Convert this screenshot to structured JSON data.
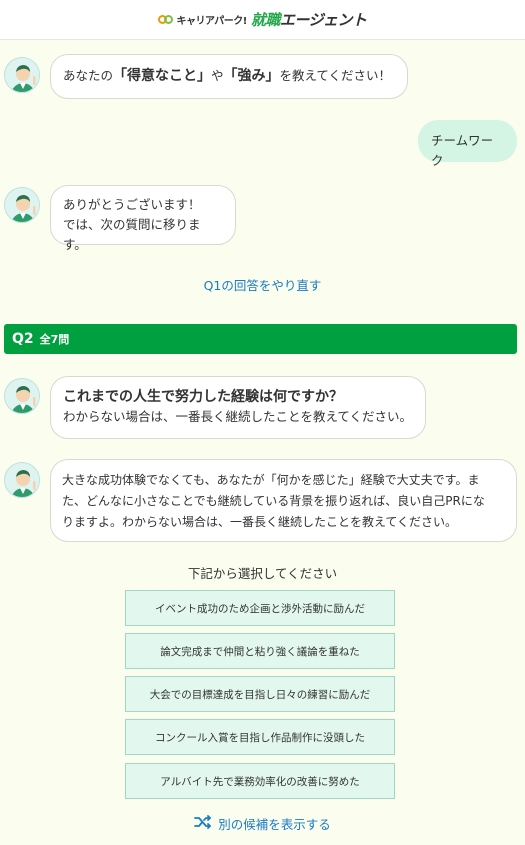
{
  "header": {
    "logo_sub": "キャリアパーク!",
    "logo_main_a": "就職",
    "logo_main_b": "エージェント"
  },
  "chat": {
    "m1": {
      "pre": "あなたの",
      "q1": "「得意なこと」",
      "mid": "や",
      "q2": "「強み」",
      "post": "を教えてください！"
    },
    "user_reply": "チームワーク",
    "m2": {
      "line1": "ありがとうございます！",
      "line2": "では、次の質問に移ります。"
    },
    "redo_link": "Q1の回答をやり直す"
  },
  "question": {
    "num": "Q2",
    "total": "全7問",
    "title": "これまでの人生で努力した経験は何ですか？",
    "sub": "わからない場合は、一番長く継続したことを教えてください。",
    "detail_1": "大きな成功体験でなくても、あなたが「何かを感じた」経験で大丈夫です。ま",
    "detail_2": "た、どんなに小さなことでも継続している背景を振り返れば、良い自己PRにな",
    "detail_3": "りますよ。わからない場合は、一番長く継続したことを教えてください。"
  },
  "choices": {
    "prompt": "下記から選択してください",
    "options": [
      "イベント成功のため企画と渉外活動に励んだ",
      "論文完成まで仲間と粘り強く議論を重ねた",
      "大会での目標達成を目指し日々の練習に励んだ",
      "コンクール入賞を目指し作品制作に没頭した",
      "アルバイト先で業務効率化の改善に努めた"
    ],
    "more_label": "別の候補を表示する"
  },
  "colors": {
    "accent_green": "#00a040",
    "link_blue": "#1a7bc7",
    "user_bubble": "#d4f4e4",
    "option_bg": "#e2f8ef",
    "background": "#fbfdee"
  },
  "icons": {
    "avatar": "advisor-avatar-icon",
    "shuffle": "shuffle-icon",
    "logo": "logo-rings-icon"
  }
}
